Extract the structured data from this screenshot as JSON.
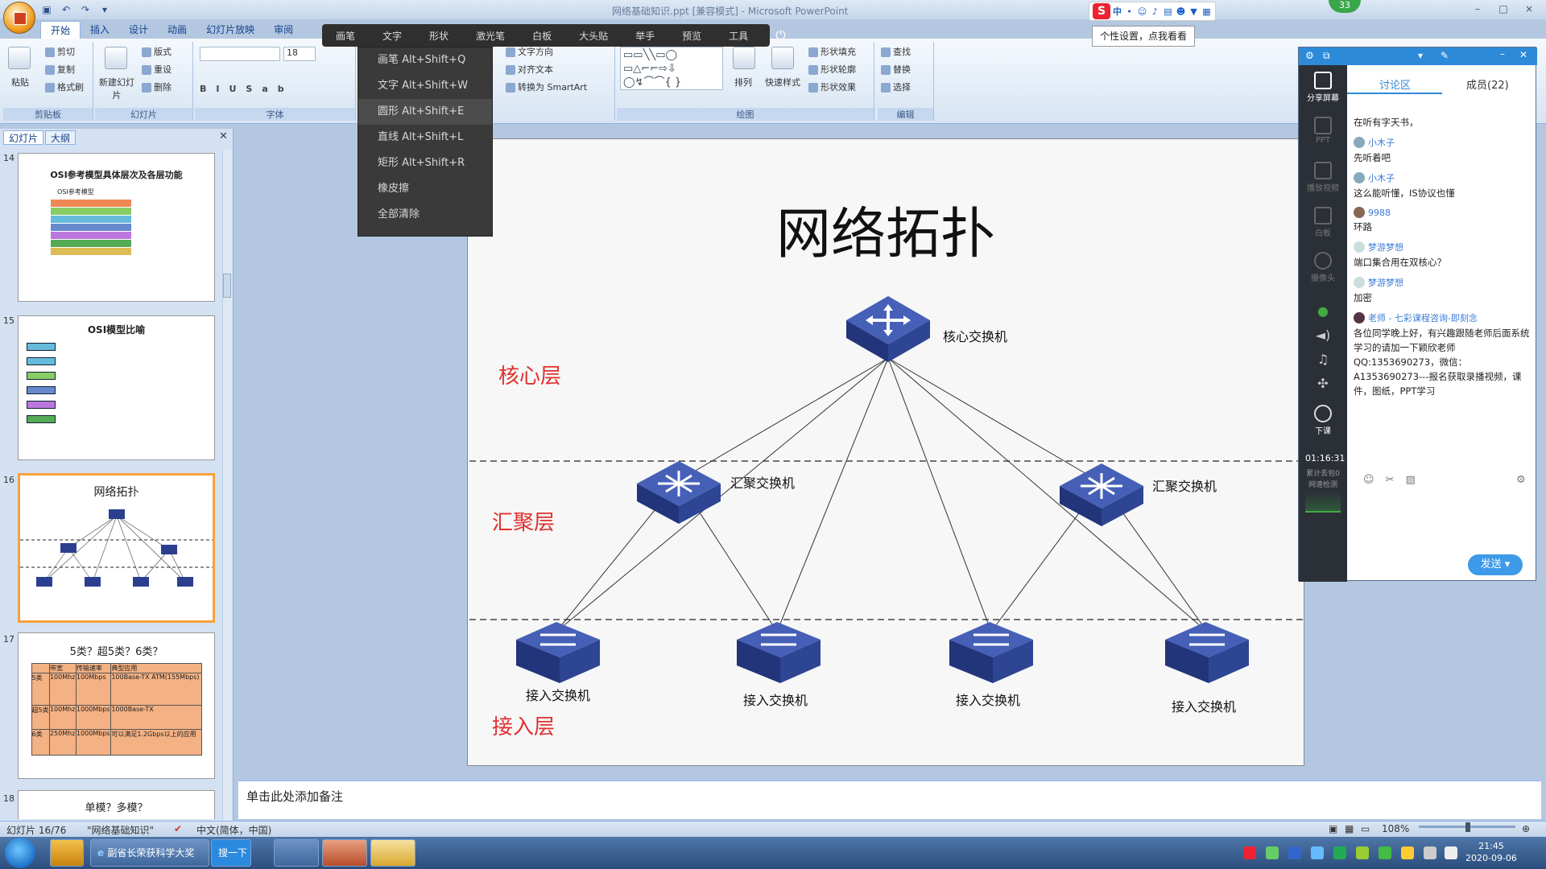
{
  "window": {
    "title": "网络基础知识.ppt [兼容模式] - Microsoft PowerPoint",
    "controls": [
      "–",
      "□",
      "×"
    ]
  },
  "ribbon": {
    "tabs": [
      "开始",
      "插入",
      "设计",
      "动画",
      "幻灯片放映",
      "审阅"
    ],
    "groups": {
      "clipboard": {
        "label": "剪贴板",
        "paste": "粘贴",
        "cut": "剪切",
        "copy": "复制",
        "format_painter": "格式刷"
      },
      "slides": {
        "label": "幻灯片",
        "new_slide": "新建幻灯片",
        "layout": "版式",
        "reset": "重设",
        "delete": "删除"
      },
      "font": {
        "label": "字体",
        "font_size": "18"
      },
      "paragraph": {
        "text_direction": "文字方向",
        "align_text": "对齐文本",
        "smartart": "转换为 SmartArt"
      },
      "drawing": {
        "label": "绘图",
        "arrange": "排列",
        "quick_styles": "快速样式",
        "shape_fill": "形状填充",
        "shape_outline": "形状轮廓",
        "shape_effects": "形状效果"
      },
      "editing": {
        "label": "编辑",
        "find": "查找",
        "replace": "替换",
        "select": "选择"
      }
    }
  },
  "annotation_toolbar": {
    "items": [
      "画笔",
      "文字",
      "形状",
      "激光笔",
      "白板",
      "大头贴",
      "举手",
      "预览",
      "工具"
    ],
    "menu": [
      {
        "label": "画笔  Alt+Shift+Q"
      },
      {
        "label": "文字  Alt+Shift+W"
      },
      {
        "label": "圆形  Alt+Shift+E"
      },
      {
        "label": "直线  Alt+Shift+L"
      },
      {
        "label": "矩形  Alt+Shift+R"
      },
      {
        "label": "橡皮擦"
      },
      {
        "label": "全部清除"
      }
    ]
  },
  "tooltip": "个性设置，点我看看",
  "ime": {
    "mode": "中"
  },
  "badge": "33",
  "left_pane": {
    "tabs": [
      "幻灯片",
      "大纲"
    ],
    "thumbs": [
      {
        "num": "14",
        "title": "OSI参考模型具体层次及各层功能",
        "sub": "OSI参考模型"
      },
      {
        "num": "15",
        "title": "OSI模型比喻"
      },
      {
        "num": "16",
        "title": "网络拓扑"
      },
      {
        "num": "17",
        "title": "5类？超5类？6类？",
        "table": [
          [
            "",
            "带宽",
            "传输速率",
            "典型应用"
          ],
          [
            "5类",
            "100Mhz",
            "100Mbps",
            "100Base-TX ATM(155Mbps)"
          ],
          [
            "超5类",
            "100Mhz",
            "1000Mbps",
            "1000Base-TX"
          ],
          [
            "6类",
            "250Mhz",
            "1000Mbps",
            "可以满足1.2Gbps以上的应用"
          ]
        ]
      },
      {
        "num": "18",
        "title": "单模？多模？"
      }
    ]
  },
  "slide": {
    "title": "网络拓扑",
    "layers": [
      "核心层",
      "汇聚层",
      "接入层"
    ],
    "core": "核心交换机",
    "aggregation": [
      "汇聚交换机",
      "汇聚交换机"
    ],
    "access": [
      "接入交换机",
      "接入交换机",
      "接入交换机",
      "接入交换机"
    ]
  },
  "notes_placeholder": "单击此处添加备注",
  "status": {
    "slide_pos": "幻灯片 16/76",
    "theme": "\"网络基础知识\"",
    "lang": "中文(简体，中国)",
    "zoom": "108%"
  },
  "chat": {
    "tabs": [
      "讨论区",
      "成员(22)"
    ],
    "side": [
      "分享屏幕",
      "PPT",
      "播放视频",
      "白板",
      "摄像头",
      "下课"
    ],
    "timer": "01:16:31",
    "side_extra": [
      "累计丢包0",
      "网速检测"
    ],
    "messages": [
      {
        "user": "",
        "text": "在听有字天书，"
      },
      {
        "user": "小木子",
        "text": "先听着吧"
      },
      {
        "user": "小木子",
        "text": "这么能听懂，IS协议也懂"
      },
      {
        "user": "9988",
        "text": "环路"
      },
      {
        "user": "梦游梦想",
        "text": "端口集合用在双核心？"
      },
      {
        "user": "梦游梦想",
        "text": "加密"
      },
      {
        "user": "老师 - 七彩课程咨询-即刻念",
        "text": "各位同学晚上好，有兴趣跟随老师后面系统学习的请加一下颖欣老师QQ:1353690273，微信：A1353690273---报名获取录播视频，课件，图纸，PPT学习"
      }
    ],
    "send": "发送"
  },
  "taskbar": {
    "ie_task": "副省长荣获科学大奖",
    "search": "搜一下",
    "clock_time": "21:45",
    "clock_date": "2020-09-06"
  }
}
